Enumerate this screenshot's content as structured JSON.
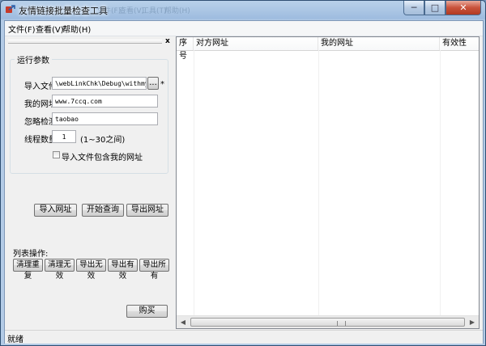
{
  "window": {
    "title": "友情链接批量检查工具",
    "ghost_texts": [
      "文件(F)",
      "查看(V)",
      "工具(T)",
      "帮助(H)"
    ],
    "minimize_glyph": "─",
    "maximize_glyph": "□",
    "close_glyph": "✕"
  },
  "menu": {
    "items": [
      "文件(F)",
      "查看(V)",
      "帮助(H)"
    ]
  },
  "left_panel": {
    "close_glyph": "x",
    "group_title": "运行参数",
    "import_file_label": "导入文件:",
    "import_file_value": "\\webLinkChk\\Debug\\withmyurl.txt",
    "browse_label": "...",
    "required_mark": "*",
    "my_url_label": "我的网址:",
    "my_url_value": "www.7ccq.com",
    "ignore_label": "忽略检测:",
    "ignore_value": "taobao",
    "threads_label": "线程数量:",
    "threads_value": "1",
    "threads_hint": "(1~30之间)",
    "include_checkbox_label": "导入文件包含我的网址",
    "include_checked": false,
    "import_button": "导入网址",
    "start_button": "开始查询",
    "export_button": "导出网址",
    "list_ops_label": "列表操作:",
    "clear_dup_button": "清理重复",
    "clear_invalid_button": "清理无效",
    "export_invalid_button": "导出无效",
    "export_valid_button": "导出有效",
    "export_all_button": "导出所有",
    "buy_button": "购买"
  },
  "list": {
    "columns": [
      "序号",
      "对方网址",
      "我的网址",
      "有效性"
    ],
    "rows": []
  },
  "status": {
    "text": "就绪"
  },
  "colors": {
    "titlebar": "#b9d1ea",
    "window_bg": "#f0f0f0",
    "close_red": "#c9523b"
  }
}
